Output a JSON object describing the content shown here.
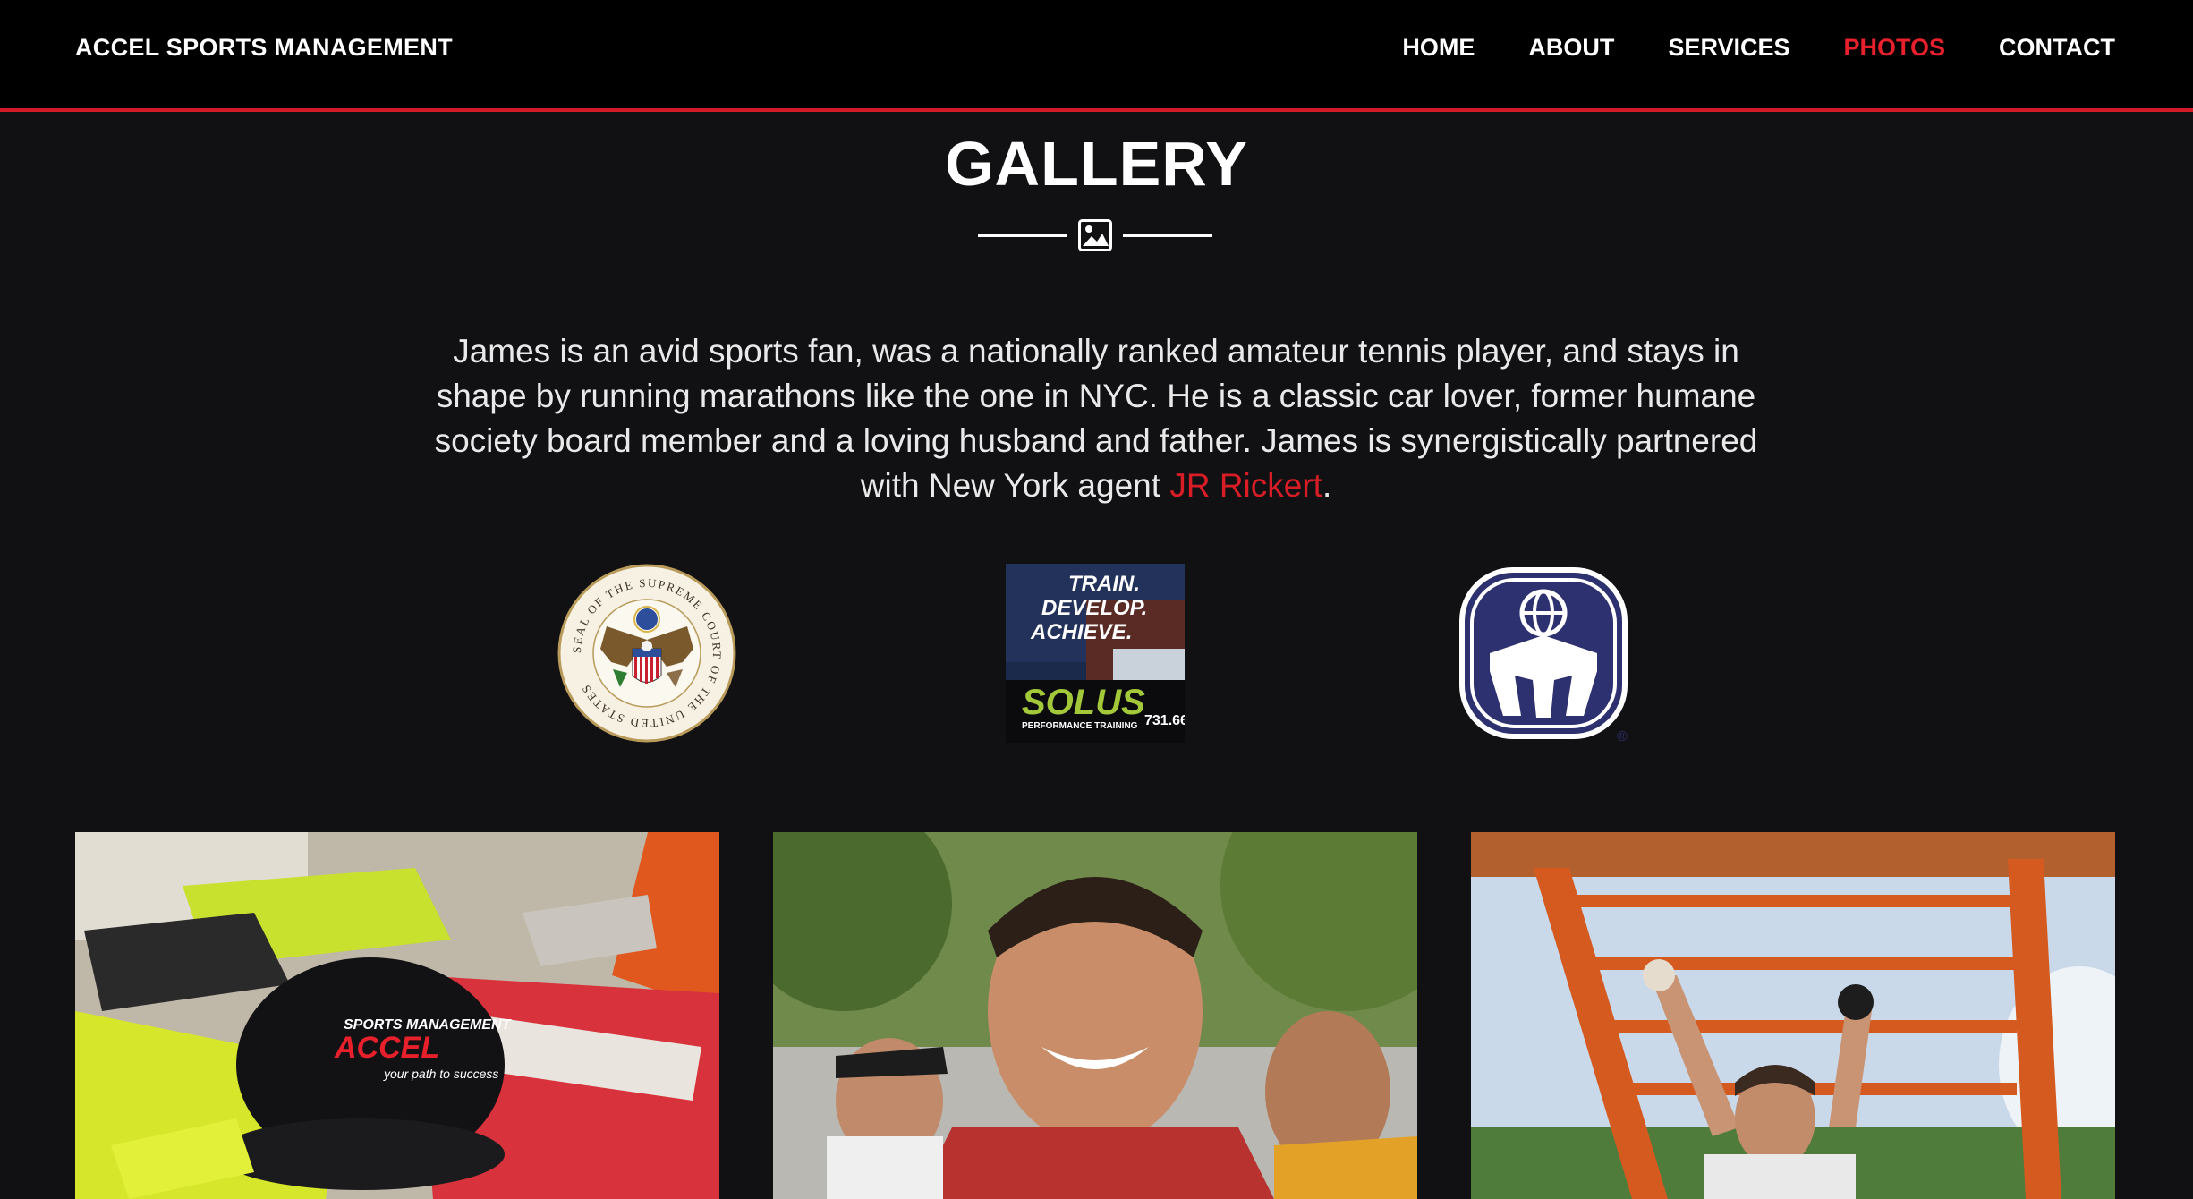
{
  "navbar": {
    "brand": "ACCEL SPORTS MANAGEMENT",
    "links": [
      {
        "label": "HOME",
        "active": false
      },
      {
        "label": "ABOUT",
        "active": false
      },
      {
        "label": "SERVICES",
        "active": false
      },
      {
        "label": "PHOTOS",
        "active": true
      },
      {
        "label": "CONTACT",
        "active": false
      }
    ],
    "accent_color": "#e8202c"
  },
  "gallery": {
    "title": "GALLERY",
    "divider_icon": "image-icon",
    "intro_text": "James is an avid sports fan, was a nationally ranked amateur tennis player, and stays in shape by running marathons like the one in NYC. He is a classic car lover, former humane society board member and a loving husband and father. James is synergistically partnered with New York agent ",
    "intro_link": "JR Rickert",
    "intro_end": "."
  },
  "logos": {
    "seal_ring_text": "SEAL OF THE SUPREME COURT OF THE UNITED STATES",
    "solus_lines": [
      "TRAIN.",
      "DEVELOP.",
      "ACHIEVE."
    ],
    "solus_brand": "SOLUS",
    "solus_sub": "PERFORMANCE TRAINING",
    "solus_phone": "731.66",
    "mensa_mark": "®"
  },
  "photos": [
    {
      "caption": "cleats-and-cap",
      "cap_text_1": "SPORTS MANAGEMENT",
      "cap_text_2": "ACCEL",
      "cap_text_3": "your path to success"
    },
    {
      "caption": "marathon-finish"
    },
    {
      "caption": "obstacle-course"
    }
  ]
}
